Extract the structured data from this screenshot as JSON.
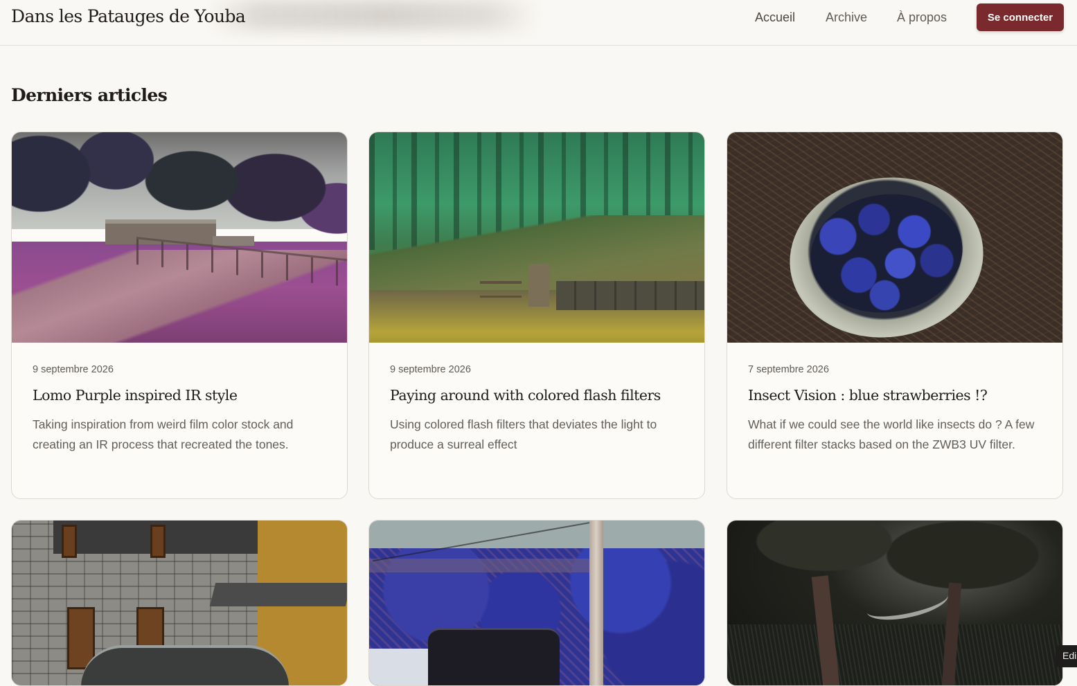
{
  "header": {
    "site_title": "Dans les Patauges de Youba",
    "nav": [
      {
        "label": "Accueil"
      },
      {
        "label": "Archive"
      },
      {
        "label": "À propos"
      }
    ],
    "login_label": "Se connecter",
    "accent_color": "#7a2a2c"
  },
  "main": {
    "section_title": "Derniers articles",
    "posts": [
      {
        "date": "9 septembre 2026",
        "title": "Lomo Purple inspired IR style",
        "excerpt": "Taking inspiration from weird film color stock and creating an IR process that recreated the tones."
      },
      {
        "date": "9 septembre 2026",
        "title": "Paying around with colored flash filters",
        "excerpt": "Using colored flash filters that deviates the light to produce a surreal effect"
      },
      {
        "date": "7 septembre 2026",
        "title": "Insect Vision : blue strawberries !?",
        "excerpt": "What if we could see the world like insects do ? A few different filter stacks based on the ZWB3 UV filter."
      },
      {
        "image_subject": "stone-building-with-car"
      },
      {
        "image_subject": "blue-ir-trees-with-car"
      },
      {
        "image_subject": "dark-orchard"
      }
    ]
  },
  "floating": {
    "edit_label": "Edi"
  }
}
